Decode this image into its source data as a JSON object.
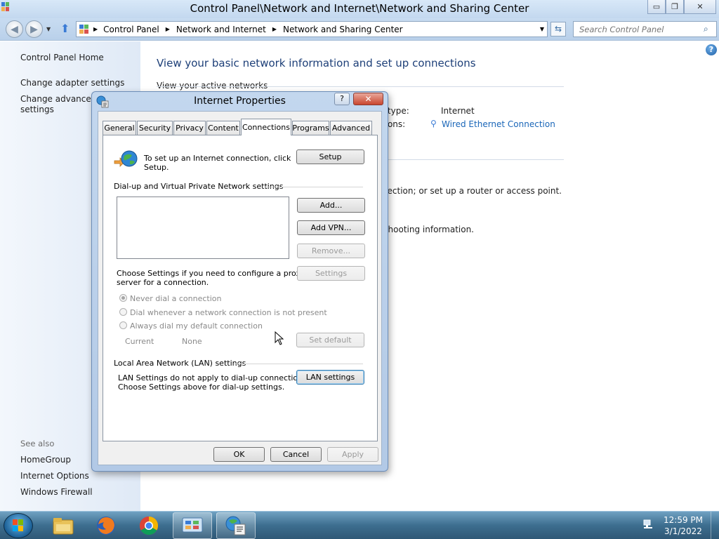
{
  "window": {
    "title": "Control Panel\\Network and Internet\\Network and Sharing Center",
    "minimize": "▭",
    "maximize": "❐",
    "close": "✕"
  },
  "addressbar": {
    "crumbs": [
      "Control Panel",
      "Network and Internet",
      "Network and Sharing Center"
    ],
    "search_placeholder": "Search Control Panel"
  },
  "left_pane": {
    "links": [
      "Control Panel Home",
      "Change adapter settings",
      "Change advanced sharing",
      "settings"
    ],
    "see_also": "See also",
    "see_also_links": [
      "HomeGroup",
      "Internet Options",
      "Windows Firewall"
    ]
  },
  "content": {
    "heading": "View your basic network information and set up connections",
    "active_networks": "View your active networks",
    "access_type_label": "Access type:",
    "access_type_value": "Internet",
    "connections_label": "Connections:",
    "connections_value": "Wired Ethernet Connection",
    "setup_text": "Set up a broadband, dial-up, or VPN connection; or set up a router or access point.",
    "troubleshoot_text": "Diagnose and repair network problems, or get troubleshooting information."
  },
  "dialog": {
    "title": "Internet Properties",
    "help": "?",
    "close": "✕",
    "tabs": [
      "General",
      "Security",
      "Privacy",
      "Content",
      "Connections",
      "Programs",
      "Advanced"
    ],
    "setup_text_1": "To set up an Internet connection, click",
    "setup_text_2": "Setup.",
    "setup_button": "Setup",
    "dialup_heading": "Dial-up and Virtual Private Network settings",
    "add_button": "Add...",
    "add_vpn_button": "Add VPN...",
    "remove_button": "Remove...",
    "settings_text_1": "Choose Settings if you need to configure a proxy",
    "settings_text_2": "server for a connection.",
    "settings_button": "Settings",
    "radio_never": "Never dial a connection",
    "radio_whenever": "Dial whenever a network connection is not present",
    "radio_always": "Always dial my default connection",
    "current_label": "Current",
    "current_value": "None",
    "set_default_button": "Set default",
    "lan_heading": "Local Area Network (LAN) settings",
    "lan_text_1": "LAN Settings do not apply to dial-up connections.",
    "lan_text_2": "Choose Settings above for dial-up settings.",
    "lan_button": "LAN settings",
    "ok_button": "OK",
    "cancel_button": "Cancel",
    "apply_button": "Apply"
  },
  "taskbar": {
    "time": "12:59 PM",
    "date": "3/1/2022"
  }
}
